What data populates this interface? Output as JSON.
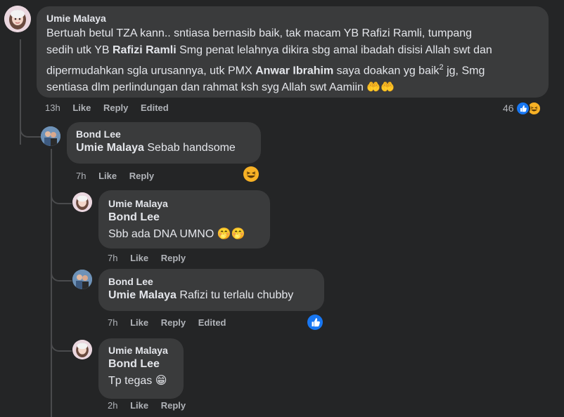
{
  "comments": [
    {
      "author": "Umie Malaya",
      "text_lines": [
        [
          "Bertuah betul TZA kann.. sntiasa bernasib baik, tak macam YB Rafizi Ramli, tumpang"
        ],
        [
          "sedih utk YB ",
          "Rafizi Ramli",
          " Smg penat lelahnya dikira sbg amal ibadah disisi Allah swt dan"
        ],
        [
          "dipermudahkan sgla urusannya, utk PMX ",
          "Anwar Ibrahim",
          " saya doakan yg baik",
          "2",
          " jg, Smg"
        ],
        [
          "sentiasa dlm perlindungan dan rahmat ksh syg Allah swt Aamiin",
          "🤲🤲"
        ]
      ],
      "time": "13h",
      "like": "Like",
      "reply": "Reply",
      "edited": "Edited",
      "reaction_count": "46"
    },
    {
      "author": "Bond Lee",
      "tag": "Umie Malaya",
      "text": " Sebab handsome",
      "time": "7h",
      "like": "Like",
      "reply": "Reply"
    },
    {
      "author": "Umie Malaya",
      "tag": "Bond Lee",
      "text": "Sbb ada DNA UMNO",
      "emoji": "🤭🤭",
      "time": "7h",
      "like": "Like",
      "reply": "Reply"
    },
    {
      "author": "Bond Lee",
      "tag": "Umie Malaya",
      "text": " Rafizi tu terlalu chubby",
      "time": "7h",
      "like": "Like",
      "reply": "Reply",
      "edited": "Edited"
    },
    {
      "author": "Umie Malaya",
      "tag": "Bond Lee",
      "text": "Tp tegas",
      "emoji": "😁",
      "time": "2h",
      "like": "Like",
      "reply": "Reply"
    }
  ],
  "colors": {
    "background": "#242526",
    "bubble": "#3a3b3c",
    "text": "#e4e6eb",
    "meta": "#b0b3b8",
    "like_blue": "#1877f2",
    "haha_yellow": "#f7b125"
  }
}
